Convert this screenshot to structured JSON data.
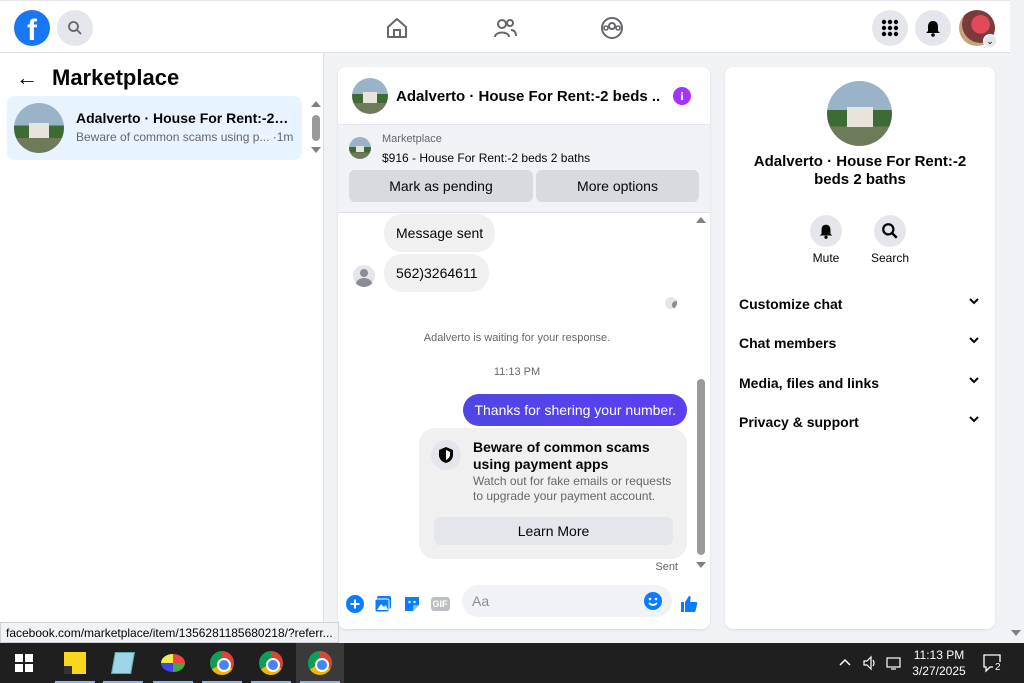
{
  "topbar": {
    "logo": "f",
    "icons": [
      "search-icon",
      "home-icon",
      "friends-icon",
      "groups-icon",
      "menu-grid-icon",
      "bell-icon"
    ]
  },
  "sidebar": {
    "back_arrow": "←",
    "title": "Marketplace",
    "conversation": {
      "name": "Adalverto · House For Rent:-2 b...",
      "preview": "Beware of common scams using p... ·1m"
    }
  },
  "chat": {
    "header_name": "Adalverto · House For Rent:-2 beds ...",
    "info_glyph": "i",
    "listing": {
      "category": "Marketplace",
      "price_title": "$916 - House For Rent:-2 beds 2 baths",
      "mark_pending": "Mark as pending",
      "more_options": "More options"
    },
    "messages": {
      "msg1": "Message sent",
      "msg2": "562)3264611",
      "waiting": "Adalverto is waiting for your response.",
      "time": "11:13 PM",
      "outgoing": "Thanks for shering your number.",
      "warning_title": "Beware of common scams using payment apps",
      "warning_body": "Watch out for fake emails or requests to upgrade your payment account.",
      "learn_more": "Learn More",
      "status": "Sent"
    },
    "composer": {
      "placeholder": "Aa",
      "gif_label": "GIF"
    }
  },
  "details": {
    "name": "Adalverto · House For Rent:-2 beds 2 baths",
    "mute_label": "Mute",
    "search_label": "Search",
    "sections": [
      "Customize chat",
      "Chat members",
      "Media, files and links",
      "Privacy & support"
    ]
  },
  "status_url": "facebook.com/marketplace/item/1356281185680218/?referr...",
  "taskbar": {
    "time": "11:13 PM",
    "date": "3/27/2025",
    "notification_count": "2"
  },
  "colors": {
    "fb_blue": "#1877f2",
    "messenger_purple": "#a334fa",
    "outgoing_bubble": "#4f46e5"
  }
}
